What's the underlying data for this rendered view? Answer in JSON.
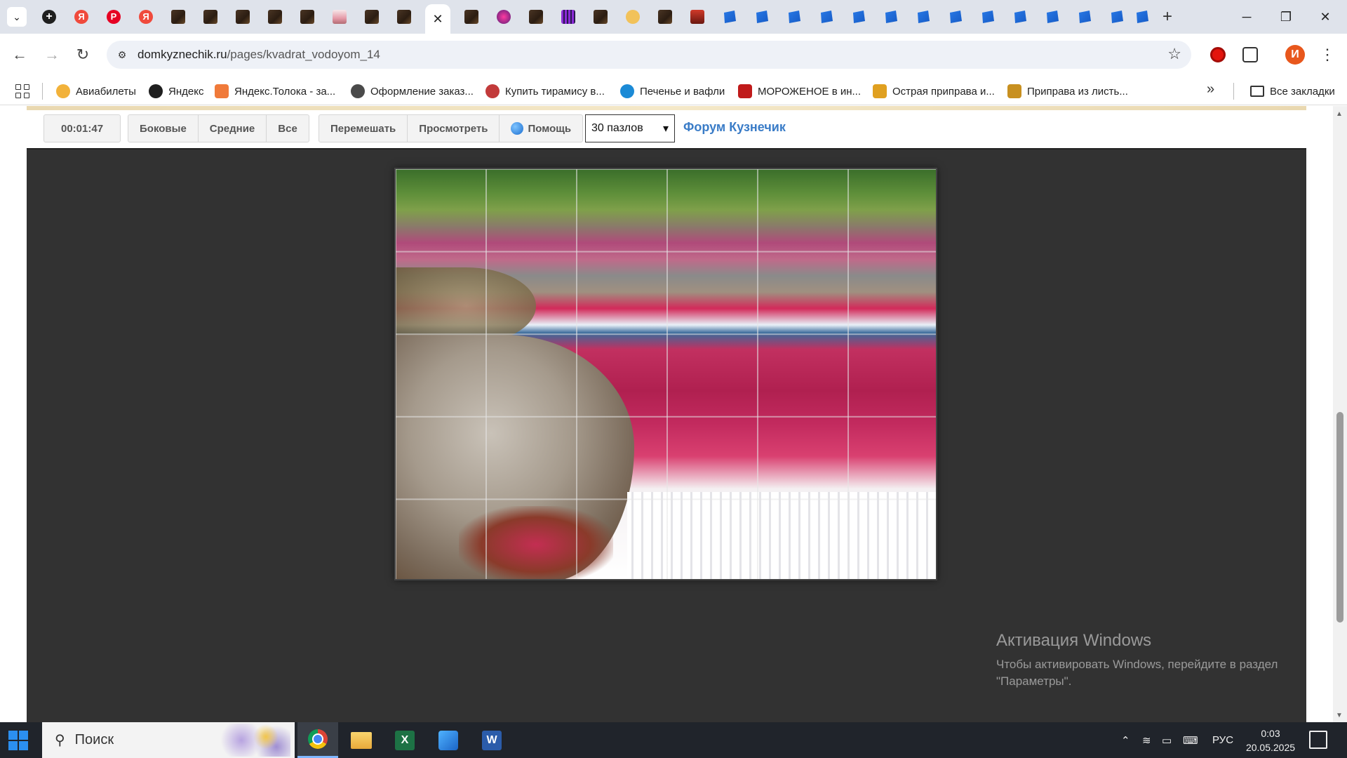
{
  "browser": {
    "address": {
      "host": "domkyznechik.ru",
      "path": "/pages/kvadrat_vodoyom_14"
    },
    "profile_initial": "И",
    "bookmarks": [
      {
        "label": "Авиабилеты",
        "color": "#f2b23a"
      },
      {
        "label": "Яндекс",
        "color": "#1f1f1f"
      },
      {
        "label": "Яндекс.Толока - за...",
        "color": "#f07a3a"
      },
      {
        "label": "Оформление заказ...",
        "color": "#4a4a4a"
      },
      {
        "label": "Купить тирамису в...",
        "color": "#c23a3a"
      },
      {
        "label": "Печенье и вафли",
        "color": "#1b8ad6"
      },
      {
        "label": "МОРОЖЕНОЕ в ин...",
        "color": "#c01a1a"
      },
      {
        "label": "Острая приправа и...",
        "color": "#e0a020"
      },
      {
        "label": "Приправа из листь...",
        "color": "#c89020"
      }
    ],
    "all_bookmarks_label": "Все закладки"
  },
  "puzzle": {
    "timer": "00:01:47",
    "mode_buttons": [
      "Боковые",
      "Средние",
      "Все"
    ],
    "action_buttons": [
      "Перемешать",
      "Просмотреть"
    ],
    "help_label": "Помощь",
    "pieces_select": "30 пазлов",
    "forum_link": "Форум Кузнечик"
  },
  "watermark": {
    "title": "Активация Windows",
    "text": "Чтобы активировать Windows, перейдите в раздел \"Параметры\"."
  },
  "taskbar": {
    "search_placeholder": "Поиск",
    "language": "РУС",
    "time": "0:03",
    "date": "20.05.2025"
  }
}
